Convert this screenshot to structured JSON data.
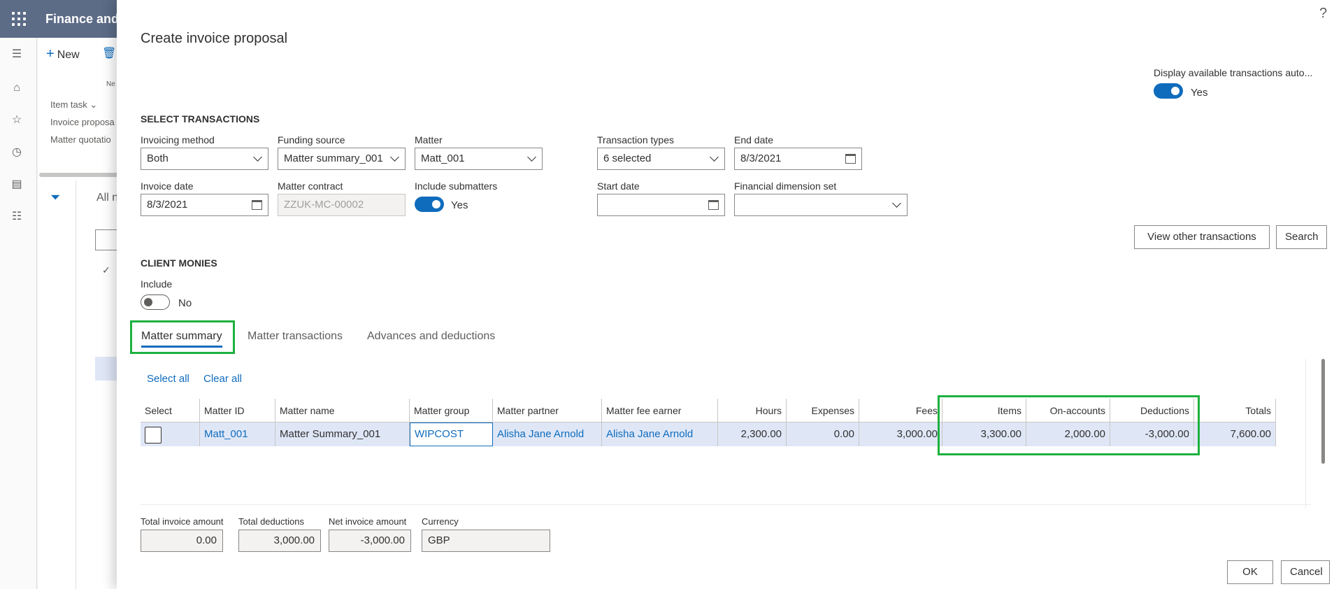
{
  "app": {
    "title": "Finance and",
    "new_label": "New",
    "ne_label": "Ne",
    "item_task_label": "Item task",
    "nav_items": [
      "Invoice proposa",
      "Matter quotatio"
    ],
    "all_label": "All n"
  },
  "dialog": {
    "title": "Create invoice proposal",
    "help_icon": "?",
    "display_available": {
      "label": "Display available transactions auto...",
      "value": "Yes",
      "on": true
    },
    "select_transactions": {
      "heading": "SELECT TRANSACTIONS",
      "invoicing_method": {
        "label": "Invoicing method",
        "value": "Both"
      },
      "funding_source": {
        "label": "Funding source",
        "value": "Matter summary_001"
      },
      "matter": {
        "label": "Matter",
        "value": "Matt_001"
      },
      "transaction_types": {
        "label": "Transaction types",
        "value": "6 selected"
      },
      "end_date": {
        "label": "End date",
        "value": "8/3/2021"
      },
      "invoice_date": {
        "label": "Invoice date",
        "value": "8/3/2021"
      },
      "matter_contract": {
        "label": "Matter contract",
        "value": "ZZUK-MC-00002"
      },
      "include_submatters": {
        "label": "Include submatters",
        "value": "Yes",
        "on": true
      },
      "start_date": {
        "label": "Start date",
        "value": ""
      },
      "financial_dimension_set": {
        "label": "Financial dimension set",
        "value": ""
      }
    },
    "buttons": {
      "view_other": "View other transactions",
      "search": "Search",
      "ok": "OK",
      "cancel": "Cancel"
    },
    "client_monies": {
      "heading": "CLIENT MONIES",
      "include_label": "Include",
      "include_value": "No",
      "on": false
    },
    "tabs": [
      {
        "label": "Matter summary",
        "active": true
      },
      {
        "label": "Matter transactions",
        "active": false
      },
      {
        "label": "Advances and deductions",
        "active": false
      }
    ],
    "select_all": "Select all",
    "clear_all": "Clear all",
    "grid": {
      "columns": [
        "Select",
        "Matter ID",
        "Matter name",
        "Matter group",
        "Matter partner",
        "Matter fee earner",
        "Hours",
        "Expenses",
        "Fees",
        "Items",
        "On-accounts",
        "Deductions",
        "Totals"
      ],
      "rows": [
        {
          "matter_id": "Matt_001",
          "matter_name": "Matter Summary_001",
          "matter_group": "WIPCOST",
          "matter_partner": "Alisha Jane Arnold",
          "matter_fee_earner": "Alisha Jane Arnold",
          "hours": "2,300.00",
          "expenses": "0.00",
          "fees": "3,000.00",
          "items": "3,300.00",
          "on_accounts": "2,000.00",
          "deductions": "-3,000.00",
          "totals": "7,600.00"
        }
      ]
    },
    "totals": {
      "total_invoice_amount": {
        "label": "Total invoice amount",
        "value": "0.00"
      },
      "total_deductions": {
        "label": "Total deductions",
        "value": "3,000.00"
      },
      "net_invoice_amount": {
        "label": "Net invoice amount",
        "value": "-3,000.00"
      },
      "currency": {
        "label": "Currency",
        "value": "GBP"
      }
    },
    "colors": {
      "accent": "#0f6cbd",
      "highlight_box": "#1db13f",
      "selected_row": "#dfe7f7"
    }
  }
}
